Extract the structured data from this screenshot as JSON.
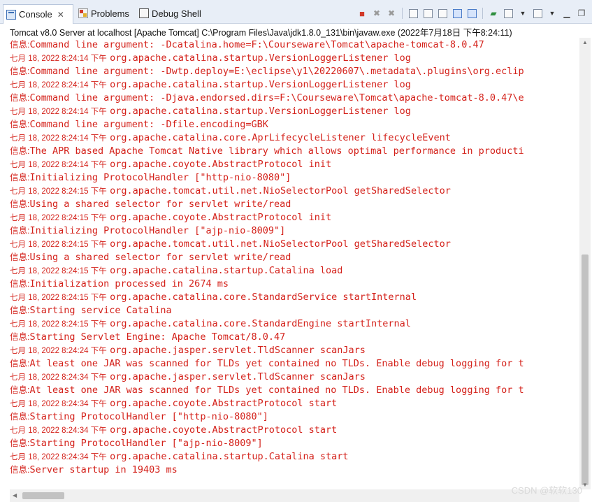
{
  "tabs": [
    {
      "label": "Console",
      "icon": "console-icon"
    },
    {
      "label": "Problems",
      "icon": "problems-icon"
    },
    {
      "label": "Debug Shell",
      "icon": "debug-shell-icon"
    }
  ],
  "process_title": "Tomcat v8.0 Server at localhost [Apache Tomcat] C:\\Program Files\\Java\\jdk1.8.0_131\\bin\\javaw.exe (2022年7月18日 下午8:24:11)",
  "colors": {
    "log_text": "#d4211a",
    "tab_bg": "#e8eef7"
  },
  "log_lines": [
    {
      "kind": "msg",
      "level": "信息:",
      "text": "Command line argument: -Dcatalina.home=F:\\Courseware\\Tomcat\\apache-tomcat-8.0.47"
    },
    {
      "kind": "ts",
      "time": "七月 18, 2022 8:24:14 下午",
      "text": "org.apache.catalina.startup.VersionLoggerListener log"
    },
    {
      "kind": "msg",
      "level": "信息:",
      "text": "Command line argument: -Dwtp.deploy=E:\\eclipse\\y1\\20220607\\.metadata\\.plugins\\org.eclip"
    },
    {
      "kind": "ts",
      "time": "七月 18, 2022 8:24:14 下午",
      "text": "org.apache.catalina.startup.VersionLoggerListener log"
    },
    {
      "kind": "msg",
      "level": "信息:",
      "text": "Command line argument: -Djava.endorsed.dirs=F:\\Courseware\\Tomcat\\apache-tomcat-8.0.47\\e"
    },
    {
      "kind": "ts",
      "time": "七月 18, 2022 8:24:14 下午",
      "text": "org.apache.catalina.startup.VersionLoggerListener log"
    },
    {
      "kind": "msg",
      "level": "信息:",
      "text": "Command line argument: -Dfile.encoding=GBK"
    },
    {
      "kind": "ts",
      "time": "七月 18, 2022 8:24:14 下午",
      "text": "org.apache.catalina.core.AprLifecycleListener lifecycleEvent"
    },
    {
      "kind": "msg",
      "level": "信息:",
      "text": "The APR based Apache Tomcat Native library which allows optimal performance in producti"
    },
    {
      "kind": "ts",
      "time": "七月 18, 2022 8:24:14 下午",
      "text": "org.apache.coyote.AbstractProtocol init"
    },
    {
      "kind": "msg",
      "level": "信息:",
      "text": "Initializing ProtocolHandler [\"http-nio-8080\"]"
    },
    {
      "kind": "ts",
      "time": "七月 18, 2022 8:24:15 下午",
      "text": "org.apache.tomcat.util.net.NioSelectorPool getSharedSelector"
    },
    {
      "kind": "msg",
      "level": "信息:",
      "text": "Using a shared selector for servlet write/read"
    },
    {
      "kind": "ts",
      "time": "七月 18, 2022 8:24:15 下午",
      "text": "org.apache.coyote.AbstractProtocol init"
    },
    {
      "kind": "msg",
      "level": "信息:",
      "text": "Initializing ProtocolHandler [\"ajp-nio-8009\"]"
    },
    {
      "kind": "ts",
      "time": "七月 18, 2022 8:24:15 下午",
      "text": "org.apache.tomcat.util.net.NioSelectorPool getSharedSelector"
    },
    {
      "kind": "msg",
      "level": "信息:",
      "text": "Using a shared selector for servlet write/read"
    },
    {
      "kind": "ts",
      "time": "七月 18, 2022 8:24:15 下午",
      "text": "org.apache.catalina.startup.Catalina load"
    },
    {
      "kind": "msg",
      "level": "信息:",
      "text": "Initialization processed in 2674 ms"
    },
    {
      "kind": "ts",
      "time": "七月 18, 2022 8:24:15 下午",
      "text": "org.apache.catalina.core.StandardService startInternal"
    },
    {
      "kind": "msg",
      "level": "信息:",
      "text": "Starting service Catalina"
    },
    {
      "kind": "ts",
      "time": "七月 18, 2022 8:24:15 下午",
      "text": "org.apache.catalina.core.StandardEngine startInternal"
    },
    {
      "kind": "msg",
      "level": "信息:",
      "text": "Starting Servlet Engine: Apache Tomcat/8.0.47"
    },
    {
      "kind": "ts",
      "time": "七月 18, 2022 8:24:24 下午",
      "text": "org.apache.jasper.servlet.TldScanner scanJars"
    },
    {
      "kind": "msg",
      "level": "信息:",
      "text": "At least one JAR was scanned for TLDs yet contained no TLDs. Enable debug logging for t"
    },
    {
      "kind": "ts",
      "time": "七月 18, 2022 8:24:34 下午",
      "text": "org.apache.jasper.servlet.TldScanner scanJars"
    },
    {
      "kind": "msg",
      "level": "信息:",
      "text": "At least one JAR was scanned for TLDs yet contained no TLDs. Enable debug logging for t"
    },
    {
      "kind": "ts",
      "time": "七月 18, 2022 8:24:34 下午",
      "text": "org.apache.coyote.AbstractProtocol start"
    },
    {
      "kind": "msg",
      "level": "信息:",
      "text": "Starting ProtocolHandler [\"http-nio-8080\"]"
    },
    {
      "kind": "ts",
      "time": "七月 18, 2022 8:24:34 下午",
      "text": "org.apache.coyote.AbstractProtocol start"
    },
    {
      "kind": "msg",
      "level": "信息:",
      "text": "Starting ProtocolHandler [\"ajp-nio-8009\"]"
    },
    {
      "kind": "ts",
      "time": "七月 18, 2022 8:24:34 下午",
      "text": "org.apache.catalina.startup.Catalina start"
    },
    {
      "kind": "msg",
      "level": "信息:",
      "text": "Server startup in 19403 ms"
    }
  ],
  "watermark": "CSDN @软软130"
}
